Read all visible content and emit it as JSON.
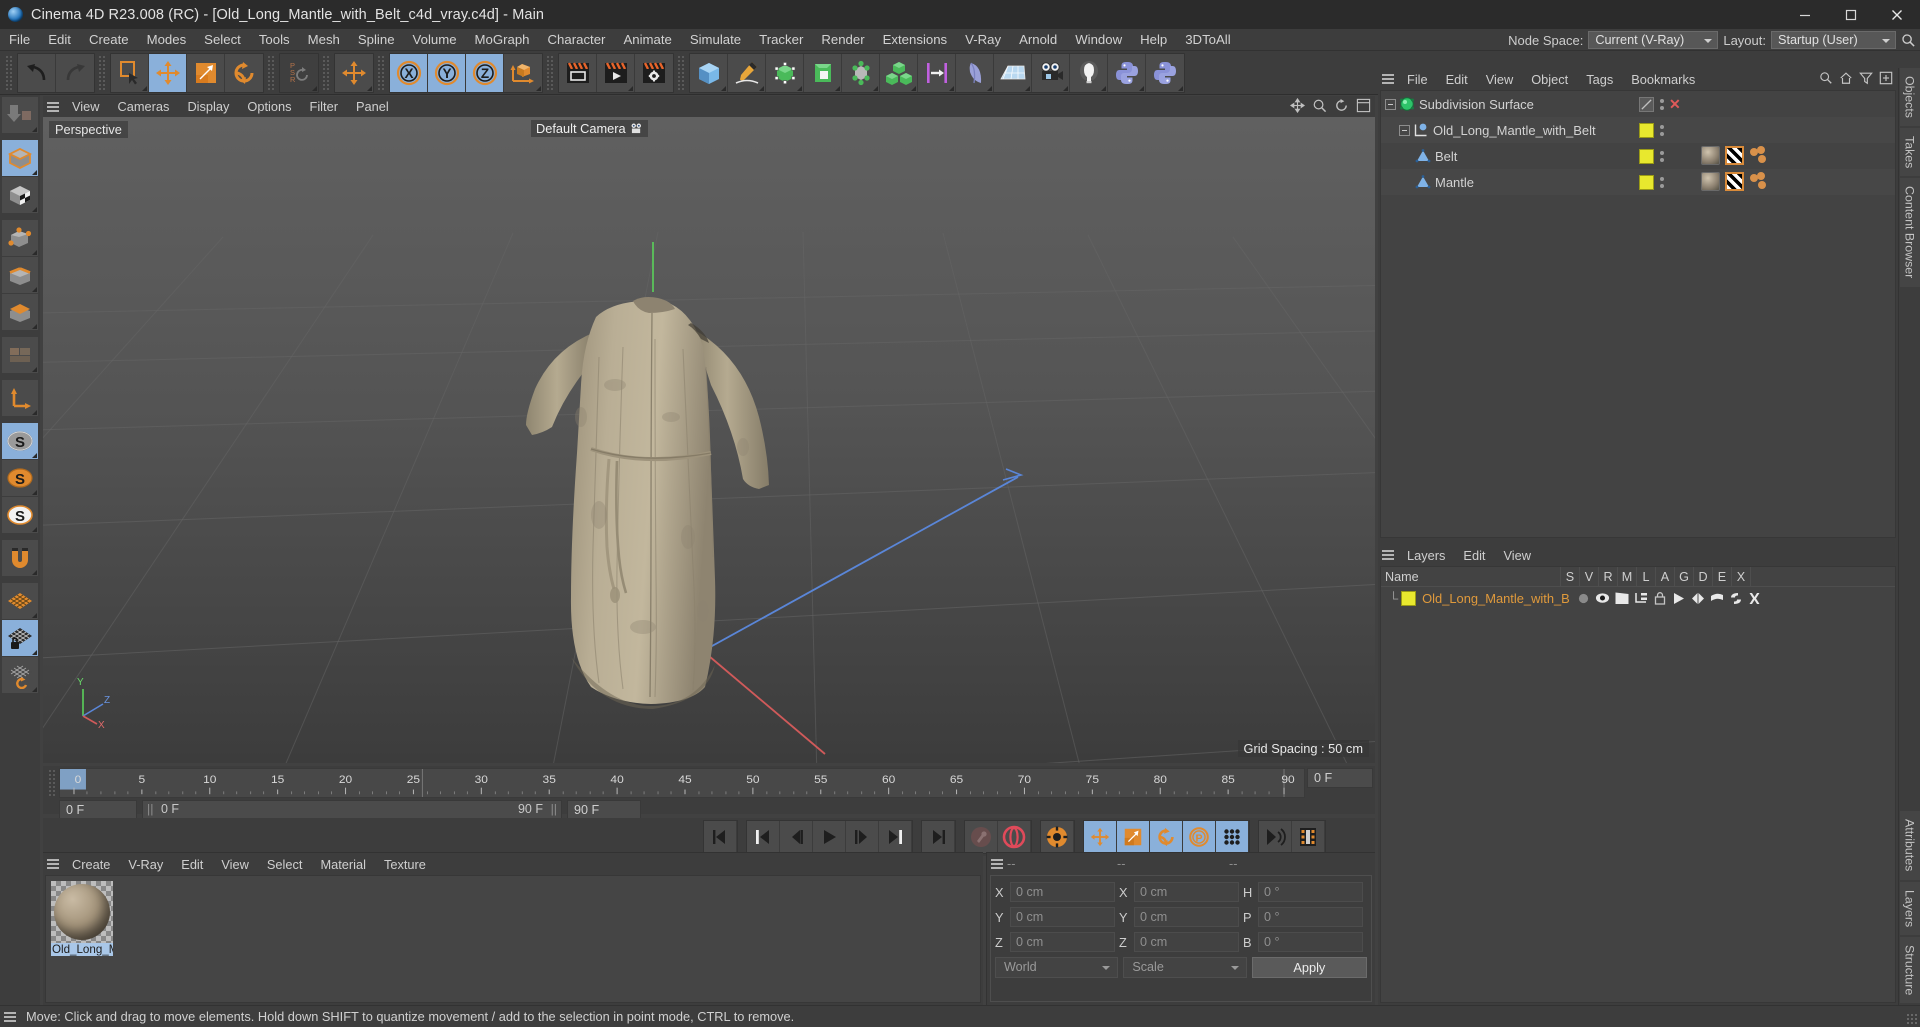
{
  "window": {
    "title": "Cinema 4D R23.008 (RC) - [Old_Long_Mantle_with_Belt_c4d_vray.c4d] - Main",
    "app_icon": "c4d-logo-icon",
    "minimize": "minimize-icon",
    "maximize": "maximize-icon",
    "close": "close-icon"
  },
  "menubar": {
    "items": [
      "File",
      "Edit",
      "Create",
      "Modes",
      "Select",
      "Tools",
      "Mesh",
      "Spline",
      "Volume",
      "MoGraph",
      "Character",
      "Animate",
      "Simulate",
      "Tracker",
      "Render",
      "Extensions",
      "V-Ray",
      "Arnold",
      "Window",
      "Help",
      "3DToAll"
    ],
    "node_space_label": "Node Space:",
    "node_space_value": "Current (V-Ray)",
    "layout_label": "Layout:",
    "layout_value": "Startup (User)",
    "search_icon": "search-icon"
  },
  "toolbar": {
    "groups": [
      {
        "buttons": [
          {
            "name": "undo-button",
            "icon": "undo-arrow-icon",
            "state": "normal"
          },
          {
            "name": "redo-button",
            "icon": "redo-arrow-icon",
            "state": "disabled"
          }
        ]
      },
      {
        "buttons": [
          {
            "name": "live-selection-button",
            "icon": "live-selection-icon",
            "state": "normal"
          },
          {
            "name": "move-tool-button",
            "icon": "move-arrows-icon",
            "state": "selected"
          },
          {
            "name": "scale-tool-button",
            "icon": "scale-icon",
            "state": "normal"
          },
          {
            "name": "rotate-tool-button",
            "icon": "rotate-icon",
            "state": "normal"
          }
        ]
      },
      {
        "buttons": [
          {
            "name": "psr-reset-button",
            "icon": "psr-reset-icon",
            "state": "dark"
          }
        ]
      },
      {
        "buttons": [
          {
            "name": "move-duplicate-button",
            "icon": "move-arrows-icon",
            "state": "normal"
          }
        ]
      },
      {
        "buttons": [
          {
            "name": "axis-x-lock-button",
            "icon": "x-axis-icon",
            "state": "selected",
            "label": "X"
          },
          {
            "name": "axis-y-lock-button",
            "icon": "y-axis-icon",
            "state": "selected",
            "label": "Y"
          },
          {
            "name": "axis-z-lock-button",
            "icon": "z-axis-icon",
            "state": "selected",
            "label": "Z"
          },
          {
            "name": "world-object-axis-button",
            "icon": "world-axis-cube-icon",
            "state": "normal"
          }
        ]
      },
      {
        "buttons": [
          {
            "name": "render-view-button",
            "icon": "render-view-icon",
            "state": "normal"
          },
          {
            "name": "render-to-picture-viewer-button",
            "icon": "render-picture-viewer-icon",
            "state": "normal"
          },
          {
            "name": "render-settings-button",
            "icon": "render-settings-gear-icon",
            "state": "normal"
          }
        ]
      },
      {
        "buttons": [
          {
            "name": "add-cube-button",
            "icon": "cube-icon",
            "state": "normal"
          },
          {
            "name": "add-spline-button",
            "icon": "pen-spline-icon",
            "state": "normal"
          },
          {
            "name": "generators-button",
            "icon": "generator-icon",
            "state": "normal"
          },
          {
            "name": "spline-generators-button",
            "icon": "spline-generator-icon",
            "state": "normal"
          },
          {
            "name": "deformers-button",
            "icon": "deformer-icon",
            "state": "normal"
          },
          {
            "name": "mograph-button",
            "icon": "mograph-cubes-icon",
            "state": "normal"
          },
          {
            "name": "field-button",
            "icon": "field-icon",
            "state": "normal"
          },
          {
            "name": "cloth-button",
            "icon": "cloth-icon",
            "state": "normal"
          },
          {
            "name": "environment-button",
            "icon": "floor-environment-icon",
            "state": "normal"
          },
          {
            "name": "camera-button",
            "icon": "camera-icon",
            "state": "normal"
          },
          {
            "name": "light-button",
            "icon": "light-bulb-icon",
            "state": "normal"
          },
          {
            "name": "python-button",
            "icon": "python-icon",
            "state": "normal"
          },
          {
            "name": "python-generator-button",
            "icon": "python-icon",
            "state": "normal"
          }
        ]
      }
    ]
  },
  "left_toolbar": {
    "buttons": [
      {
        "name": "make-editable-button",
        "icon": "make-editable-icon",
        "state": "normal"
      },
      {
        "name": "model-mode-button",
        "icon": "model-cube-icon",
        "state": "selected"
      },
      {
        "name": "texture-mode-button",
        "icon": "texture-cube-icon",
        "state": "normal"
      },
      {
        "name": "points-mode-button",
        "icon": "points-mode-icon",
        "state": "normal"
      },
      {
        "name": "edges-mode-button",
        "icon": "edges-mode-icon",
        "state": "normal"
      },
      {
        "name": "polygons-mode-button",
        "icon": "polygons-mode-icon",
        "state": "normal"
      },
      {
        "name": "viewport-solo-button",
        "icon": "viewport-solo-icon",
        "state": "normal"
      },
      {
        "name": "axis-modify-button",
        "icon": "axis-modify-icon",
        "state": "normal"
      },
      {
        "name": "world-coordinates-button",
        "icon": "s-world-icon",
        "state": "selected"
      },
      {
        "name": "object-coordinates-button",
        "icon": "s-object-icon",
        "state": "normal"
      },
      {
        "name": "scale-snap-button",
        "icon": "s-scale-icon",
        "state": "normal"
      },
      {
        "name": "snap-magnet-button",
        "icon": "magnet-icon",
        "state": "normal"
      },
      {
        "name": "grid-workplane-button",
        "icon": "grid-plane-icon",
        "state": "normal"
      },
      {
        "name": "lock-workplane-button",
        "icon": "grid-lock-icon",
        "state": "selected"
      },
      {
        "name": "planar-workplane-button",
        "icon": "grid-rotate-icon",
        "state": "normal"
      }
    ]
  },
  "viewport": {
    "menu": [
      "View",
      "Cameras",
      "Display",
      "Options",
      "Filter",
      "Panel"
    ],
    "menu_hamburger": "hamburger-icon",
    "view_label": "Perspective",
    "camera_label": "Default Camera",
    "camera_icon": "camera-small-icon",
    "grid_spacing": "Grid Spacing : 50 cm",
    "axis_hud": {
      "x": "X",
      "y": "Y",
      "z": "Z"
    },
    "corner_icons": [
      "pan-icon",
      "zoom-icon",
      "rotate-icon",
      "maximize-view-icon"
    ]
  },
  "timeline": {
    "ticks": [
      "0",
      "5",
      "10",
      "15",
      "20",
      "25",
      "30",
      "35",
      "40",
      "45",
      "50",
      "55",
      "60",
      "65",
      "70",
      "75",
      "80",
      "85",
      "90"
    ],
    "current_frame": "0 F",
    "range_start": "0 F",
    "range_end": "90 F",
    "max_frame": "90 F",
    "preview_frame": "0 F",
    "playhead_frame": 0
  },
  "playback": {
    "buttons": [
      {
        "name": "go-to-start-button",
        "icon": "skip-start-icon",
        "state": "normal"
      },
      {
        "name": "go-to-previous-key-button",
        "icon": "prev-key-icon",
        "state": "normal"
      },
      {
        "name": "step-back-button",
        "icon": "step-back-icon",
        "state": "normal"
      },
      {
        "name": "play-button",
        "icon": "play-icon",
        "state": "normal"
      },
      {
        "name": "step-forward-button",
        "icon": "step-forward-icon",
        "state": "normal"
      },
      {
        "name": "go-to-next-key-button",
        "icon": "next-key-icon",
        "state": "normal"
      },
      {
        "name": "go-to-end-button",
        "icon": "skip-end-icon",
        "state": "normal"
      },
      {
        "name": "record-active-objects-button",
        "icon": "record-key-icon",
        "state": "dim"
      },
      {
        "name": "autokeying-button",
        "icon": "autokey-icon",
        "state": "normal"
      },
      {
        "name": "keyframe-settings-button",
        "icon": "key-gear-icon",
        "state": "normal"
      },
      {
        "name": "record-position-button",
        "icon": "position-arrows-icon",
        "state": "selected"
      },
      {
        "name": "record-scale-button",
        "icon": "scale-key-icon",
        "state": "selected"
      },
      {
        "name": "record-rotation-button",
        "icon": "rotation-key-icon",
        "state": "selected"
      },
      {
        "name": "record-param-button",
        "icon": "param-p-icon",
        "state": "selected"
      },
      {
        "name": "record-pla-button",
        "icon": "point-level-anim-icon",
        "state": "selected"
      },
      {
        "name": "sound-button",
        "icon": "sound-icon",
        "state": "normal"
      },
      {
        "name": "filmstrip-button",
        "icon": "filmstrip-icon",
        "state": "normal"
      }
    ]
  },
  "material_manager": {
    "menu": [
      "Create",
      "V-Ray",
      "Edit",
      "View",
      "Select",
      "Material",
      "Texture"
    ],
    "hamburger": "hamburger-icon",
    "materials": [
      {
        "name": "Old_Long_M",
        "full_name": "Old_Long_Mantle_with_Belt",
        "selected": true
      }
    ]
  },
  "coordinates": {
    "hamburger": "hamburger-icon",
    "headers": [
      "--",
      "--",
      "--"
    ],
    "rows": [
      {
        "pos_label": "X",
        "pos_value": "0 cm",
        "size_label": "X",
        "size_value": "0 cm",
        "rot_label": "H",
        "rot_value": "0 °"
      },
      {
        "pos_label": "Y",
        "pos_value": "0 cm",
        "size_label": "Y",
        "size_value": "0 cm",
        "rot_label": "P",
        "rot_value": "0 °"
      },
      {
        "pos_label": "Z",
        "pos_value": "0 cm",
        "size_label": "Z",
        "size_value": "0 cm",
        "rot_label": "B",
        "rot_value": "0 °"
      }
    ],
    "coord_system": "World",
    "transform_mode": "Scale",
    "apply_label": "Apply"
  },
  "object_manager": {
    "hamburger": "hamburger-icon",
    "menu": [
      "File",
      "Edit",
      "View",
      "Object",
      "Tags",
      "Bookmarks"
    ],
    "icons": [
      "search-icon",
      "home-icon",
      "filter-icon",
      "add-layer-icon"
    ],
    "objects": [
      {
        "name": "Subdivision Surface",
        "icon": "subdivision-surface-icon",
        "depth": 0,
        "expandable": true,
        "layer_color": null,
        "enabled_toggle": true,
        "disabled_x": true,
        "tags": []
      },
      {
        "name": "Old_Long_Mantle_with_Belt",
        "icon": "null-object-icon",
        "depth": 1,
        "expandable": true,
        "layer_color": "#e8e82e",
        "tags": []
      },
      {
        "name": "Belt",
        "icon": "polygon-object-icon",
        "depth": 2,
        "expandable": false,
        "layer_color": "#e8e82e",
        "tags": [
          "material-tag",
          "uv-tag",
          "selection-tag"
        ]
      },
      {
        "name": "Mantle",
        "icon": "polygon-object-icon",
        "depth": 2,
        "expandable": false,
        "layer_color": "#e8e82e",
        "tags": [
          "material-tag",
          "uv-tag",
          "selection-tag"
        ]
      }
    ]
  },
  "layer_manager": {
    "hamburger": "hamburger-icon",
    "menu": [
      "Layers",
      "Edit",
      "View"
    ],
    "columns": [
      "Name",
      "S",
      "V",
      "R",
      "M",
      "L",
      "A",
      "G",
      "D",
      "E",
      "X"
    ],
    "rows": [
      {
        "name": "Old_Long_Mantle_with_Belt",
        "color": "#e8e82e",
        "text_color": "#e09a3c",
        "toggles": [
          "solo-dot-icon",
          "eye-icon",
          "render-clapper-icon",
          "manager-icon",
          "lock-icon",
          "animation-play-icon",
          "generator-icon",
          "deformer-icon",
          "expression-icon",
          "xref-icon"
        ]
      }
    ]
  },
  "dock_tabs": [
    "Objects",
    "Takes",
    "Content Browser",
    "Attributes",
    "Layers",
    "Structure"
  ],
  "statusbar": {
    "hamburger": "hamburger-icon",
    "text": "Move: Click and drag to move elements. Hold down SHIFT to quantize movement / add to the selection in point mode, CTRL to remove."
  },
  "colors": {
    "accent_orange": "#e08a2e",
    "selected_blue": "#8ab0da",
    "layer_yellow": "#e8e82e",
    "panel_bg": "#3d3d3d",
    "field_bg": "#4b4b4b",
    "axis_x_red": "#d05a5a",
    "axis_y_green": "#63c063",
    "axis_z_blue": "#5a86d0"
  }
}
